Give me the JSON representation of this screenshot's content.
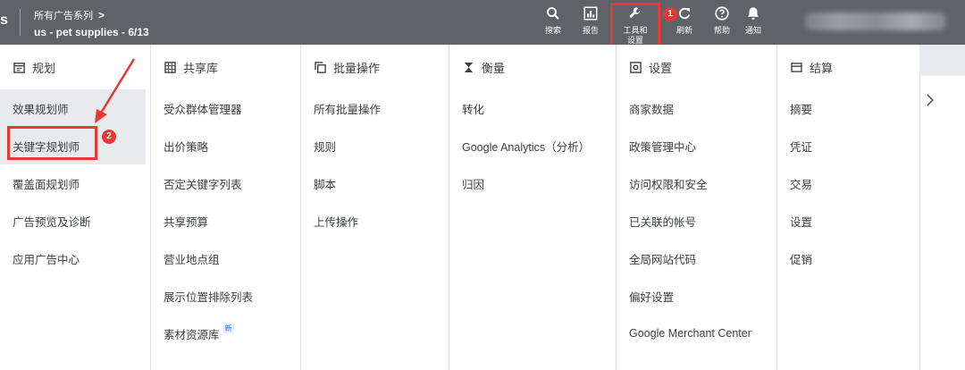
{
  "topbar": {
    "brand_fragment": "s",
    "account_path": "所有广告系列",
    "account_path_chevron": ">",
    "account_name": "us - pet supplies - 6/13",
    "buttons": [
      {
        "label": "搜索",
        "icon": "search-icon"
      },
      {
        "label": "报告",
        "icon": "reports-icon"
      },
      {
        "label": "工具和设置",
        "icon": "wrench-icon"
      },
      {
        "label": "刷新",
        "icon": "refresh-icon"
      },
      {
        "label": "帮助",
        "icon": "help-icon"
      },
      {
        "label": "通知",
        "icon": "bell-icon"
      }
    ]
  },
  "annotations": {
    "badge1": "1",
    "badge2": "2"
  },
  "columns": [
    {
      "heading": "规划",
      "icon": "calendar-icon",
      "items": [
        "效果规划师",
        "关键字规划师",
        "覆盖面规划师",
        "广告预览及诊断",
        "应用广告中心"
      ]
    },
    {
      "heading": "共享库",
      "icon": "grid-icon",
      "items": [
        "受众群体管理器",
        "出价策略",
        "否定关键字列表",
        "共享预算",
        "营业地点组",
        "展示位置排除列表",
        "素材资源库"
      ],
      "new_badge": "新"
    },
    {
      "heading": "批量操作",
      "icon": "copy-icon",
      "items": [
        "所有批量操作",
        "规则",
        "脚本",
        "上传操作"
      ]
    },
    {
      "heading": "衡量",
      "icon": "hourglass-icon",
      "items": [
        "转化",
        "Google Analytics（分析）",
        "归因"
      ]
    },
    {
      "heading": "设置",
      "icon": "settings-box-icon",
      "items": [
        "商家数据",
        "政策管理中心",
        "访问权限和安全",
        "已关联的帐号",
        "全局网站代码",
        "偏好设置",
        "Google Merchant Center"
      ]
    },
    {
      "heading": "结算",
      "icon": "card-icon",
      "items": [
        "摘要",
        "凭证",
        "交易",
        "设置",
        "促销"
      ]
    }
  ],
  "colors": {
    "topbar": "#5f6368",
    "highlight": "#e53935",
    "selected_bg": "#e8eaed"
  }
}
